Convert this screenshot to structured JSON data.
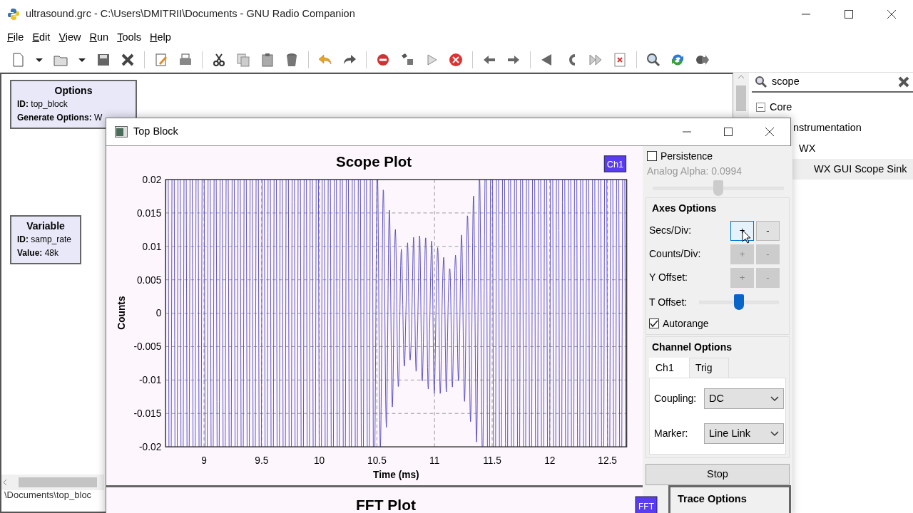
{
  "window": {
    "title": "ultrasound.grc - C:\\Users\\DMITRII\\Documents - GNU Radio Companion"
  },
  "menu": [
    {
      "label": "File"
    },
    {
      "label": "Edit"
    },
    {
      "label": "View"
    },
    {
      "label": "Run"
    },
    {
      "label": "Tools"
    },
    {
      "label": "Help"
    }
  ],
  "blocks": [
    {
      "title": "Options",
      "params": [
        {
          "key": "ID:",
          "value": "top_block"
        },
        {
          "key": "Generate Options:",
          "value": "W"
        }
      ]
    },
    {
      "title": "Variable",
      "params": [
        {
          "key": "ID:",
          "value": "samp_rate"
        },
        {
          "key": "Value:",
          "value": "48k"
        }
      ]
    }
  ],
  "status_path": "\\Documents\\top_bloc",
  "block_search": {
    "value": "scope"
  },
  "block_tree": [
    {
      "label": "Core",
      "expanded": true,
      "selected": false,
      "children": [
        {
          "label": "nstrumentation",
          "selected": false,
          "children": [
            {
              "label": "WX",
              "selected": false,
              "children": [
                {
                  "label": "WX GUI Scope Sink",
                  "selected": true
                }
              ]
            }
          ]
        }
      ]
    }
  ],
  "scope_window": {
    "title": "Top Block",
    "scope": {
      "title": "Scope Plot",
      "badge": "Ch1",
      "ylabel": "Counts",
      "xlabel": "Time (ms)",
      "yticks": [
        "0.02",
        "0.015",
        "0.01",
        "0.005",
        "0",
        "-0.005",
        "-0.01",
        "-0.015",
        "-0.02"
      ],
      "xticks": [
        "9",
        "9.5",
        "10",
        "10.5",
        "11",
        "11.5",
        "12",
        "12.5"
      ]
    },
    "fft": {
      "title": "FFT Plot",
      "badge": "FFT"
    },
    "controls": {
      "persistence": {
        "label": "Persistence",
        "checked": false
      },
      "alpha": {
        "label": "Analog Alpha: 0.0994",
        "disabled": true,
        "level": 0.5
      },
      "axes_heading": "Axes Options",
      "axes_rows": [
        {
          "kind": "buttons",
          "label": "Secs/Div:",
          "plus": "+",
          "minus": "-",
          "disabled": false,
          "highlighted": true
        },
        {
          "kind": "buttons",
          "label": "Counts/Div:",
          "plus": "+",
          "minus": "-",
          "disabled": true,
          "highlighted": false
        },
        {
          "kind": "buttons",
          "label": "Y Offset:",
          "plus": "+",
          "minus": "-",
          "disabled": true,
          "highlighted": false
        },
        {
          "kind": "slider",
          "label": "T Offset:",
          "level": 0.5
        }
      ],
      "autorange": {
        "label": "Autorange",
        "checked": true
      },
      "channel_heading": "Channel Options",
      "channel_tabs": [
        {
          "label": "Ch1",
          "selected": true
        },
        {
          "label": "Trig",
          "selected": false
        }
      ],
      "channel_fields": [
        {
          "label": "Coupling:",
          "value": "DC"
        },
        {
          "label": "Marker:",
          "value": "Line Link"
        }
      ],
      "stop_button": "Stop",
      "trace_heading": "Trace Options"
    }
  }
}
